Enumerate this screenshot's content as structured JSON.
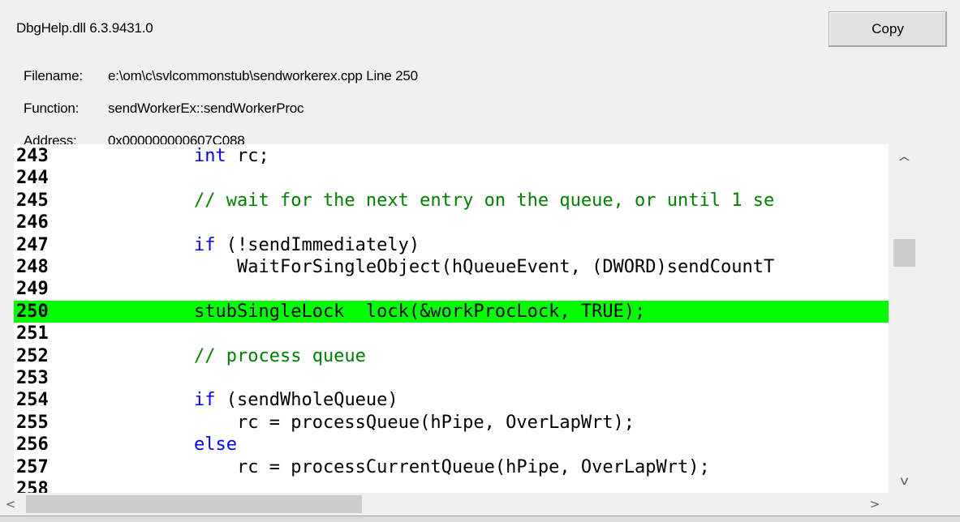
{
  "header": {
    "dll_version": "DbgHelp.dll 6.3.9431.0",
    "filename_label": "Filename:",
    "filename_value": "e:\\om\\c\\svlcommonstub\\sendworkerex.cpp Line 250",
    "function_label": "Function:",
    "function_value": "sendWorkerEx::sendWorkerProc",
    "address_label": "Address:",
    "address_value": "0x000000000607C088"
  },
  "buttons": {
    "copy_label": "Copy"
  },
  "code": {
    "highlighted_line": "250",
    "highlight_color": "#00ff00",
    "keyword_color": "#0000ff",
    "comment_color": "#008000",
    "lines": [
      {
        "num": "243",
        "kw": "int",
        "rest": " rc;"
      },
      {
        "num": "244"
      },
      {
        "num": "245",
        "comment": "// wait for the next entry on the queue, or until 1 se"
      },
      {
        "num": "246"
      },
      {
        "num": "247",
        "kw": "if",
        "rest": " (!sendImmediately)"
      },
      {
        "num": "248",
        "text": "    WaitForSingleObject(hQueueEvent, (DWORD)sendCountT"
      },
      {
        "num": "249"
      },
      {
        "num": "250",
        "text": "stubSingleLock  lock(&workProcLock, TRUE);"
      },
      {
        "num": "251"
      },
      {
        "num": "252",
        "comment": "// process queue"
      },
      {
        "num": "253"
      },
      {
        "num": "254",
        "kw": "if",
        "rest": " (sendWholeQueue)"
      },
      {
        "num": "255",
        "text": "    rc = processQueue(hPipe, OverLapWrt);"
      },
      {
        "num": "256",
        "kw": "else"
      },
      {
        "num": "257",
        "text": "    rc = processCurrentQueue(hPipe, OverLapWrt);"
      },
      {
        "num": "258"
      }
    ]
  },
  "scrollbars": {
    "up_arrow": "^",
    "down_arrow": "v",
    "left_arrow": "<",
    "right_arrow": ">"
  }
}
